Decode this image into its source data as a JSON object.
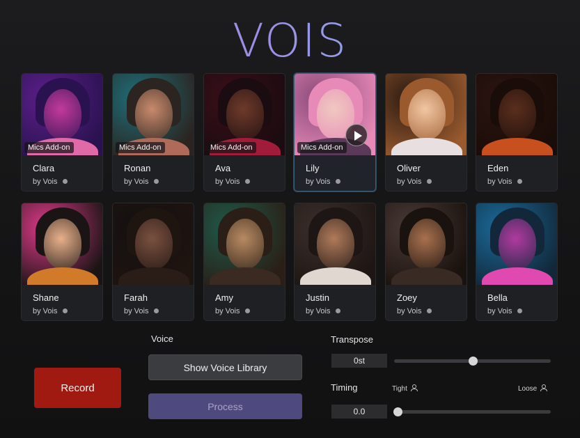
{
  "app": {
    "logo_text": "VOIS"
  },
  "voices": [
    {
      "name": "Clara",
      "by": "by Vois",
      "badge": "Mics Add-on",
      "palette": [
        "#5b1f8a",
        "#c23a9c",
        "#2a1250",
        "#e06aa8"
      ],
      "selected": false,
      "play": false
    },
    {
      "name": "Ronan",
      "by": "by Vois",
      "badge": "Mics Add-on",
      "palette": [
        "#1d6f7a",
        "#c98a6c",
        "#2b2420",
        "#b06a5a"
      ],
      "selected": false,
      "play": false
    },
    {
      "name": "Ava",
      "by": "by Vois",
      "badge": "Mics Add-on",
      "palette": [
        "#3a0e18",
        "#6e3a2a",
        "#1a0c10",
        "#a01c38"
      ],
      "selected": false,
      "play": false
    },
    {
      "name": "Lily",
      "by": "by Vois",
      "badge": "Mics Add-on",
      "palette": [
        "#8a4a7a",
        "#f0c8c0",
        "#e88ab8",
        "#5a3a58"
      ],
      "selected": true,
      "play": true
    },
    {
      "name": "Oliver",
      "by": "by Vois",
      "badge": "",
      "palette": [
        "#2a1a12",
        "#f2c6a2",
        "#9a5a2e",
        "#e8e0e0"
      ],
      "selected": false,
      "play": false
    },
    {
      "name": "Eden",
      "by": "by Vois",
      "badge": "",
      "palette": [
        "#2a1410",
        "#5a2e1e",
        "#1a0c08",
        "#c8501e"
      ],
      "selected": false,
      "play": false
    },
    {
      "name": "Shane",
      "by": "by Vois",
      "badge": "",
      "palette": [
        "#e03a8a",
        "#e8b08a",
        "#1a1414",
        "#d07a2a"
      ],
      "selected": false,
      "play": false
    },
    {
      "name": "Farah",
      "by": "by Vois",
      "badge": "",
      "palette": [
        "#141010",
        "#7a5040",
        "#1e1410",
        "#2a1c16"
      ],
      "selected": false,
      "play": false
    },
    {
      "name": "Amy",
      "by": "by Vois",
      "badge": "",
      "palette": [
        "#1e5a4a",
        "#b88a62",
        "#2a1e16",
        "#3a2a22"
      ],
      "selected": false,
      "play": false
    },
    {
      "name": "Justin",
      "by": "by Vois",
      "badge": "",
      "palette": [
        "#3a2e2a",
        "#b07a5a",
        "#1e1614",
        "#e0d8d0"
      ],
      "selected": false,
      "play": false
    },
    {
      "name": "Zoey",
      "by": "by Vois",
      "badge": "",
      "palette": [
        "#4a3a36",
        "#a8704e",
        "#1a120e",
        "#3a2a24"
      ],
      "selected": false,
      "play": false
    },
    {
      "name": "Bella",
      "by": "by Vois",
      "badge": "",
      "palette": [
        "#1a6a9a",
        "#b03aa0",
        "#12283a",
        "#e04ab0"
      ],
      "selected": false,
      "play": false
    }
  ],
  "controls": {
    "record_label": "Record",
    "voice_label": "Voice",
    "library_button": "Show Voice Library",
    "process_button": "Process",
    "transpose_label": "Transpose",
    "transpose_value": "0st",
    "transpose_fraction": 0.5,
    "timing_label": "Timing",
    "timing_value": "0.0",
    "timing_fraction": 0.0,
    "tight_label": "Tight",
    "loose_label": "Loose"
  }
}
